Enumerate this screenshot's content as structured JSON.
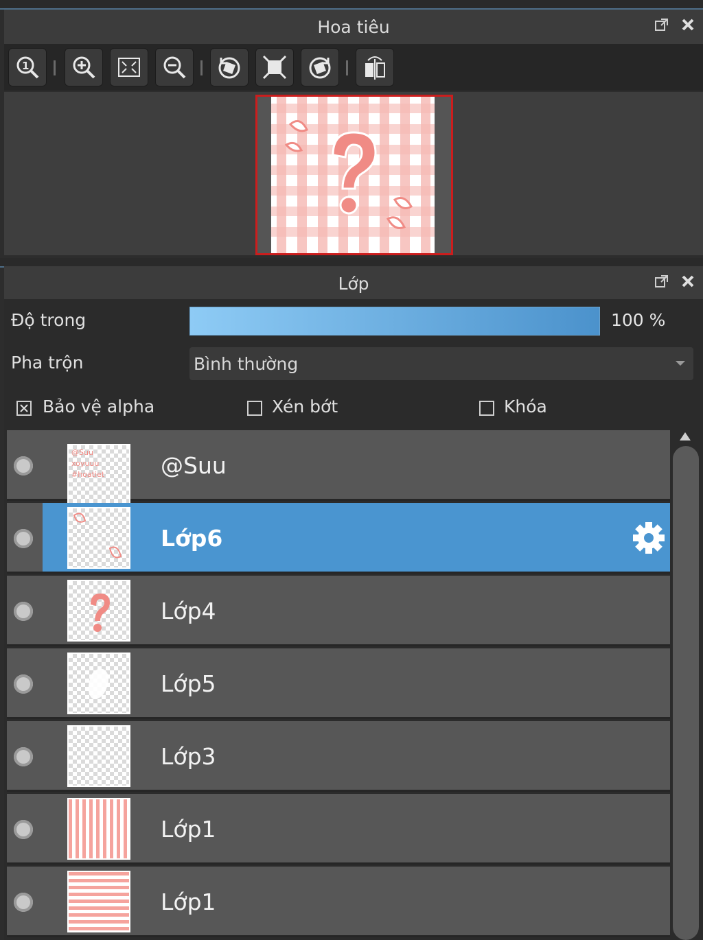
{
  "navigator": {
    "title": "Hoa tiêu",
    "toolbar": [
      {
        "icon": "zoom-actual-size-icon"
      },
      {
        "icon": "zoom-in-icon"
      },
      {
        "icon": "fit-to-window-icon"
      },
      {
        "icon": "zoom-out-icon"
      },
      {
        "icon": "rotate-left-icon"
      },
      {
        "icon": "reset-view-icon"
      },
      {
        "icon": "rotate-right-icon"
      },
      {
        "icon": "flip-horizontal-icon"
      }
    ]
  },
  "layers_panel": {
    "title": "Lớp",
    "opacity_label": "Độ trong",
    "opacity_value": "100 %",
    "opacity_fraction": 1.0,
    "blend_label": "Pha trộn",
    "blend_mode": "Bình thường",
    "checkboxes": {
      "protect_alpha": {
        "label": "Bảo vệ alpha",
        "checked": true
      },
      "clipping": {
        "label": "Xén bớt",
        "checked": false
      },
      "lock": {
        "label": "Khóa",
        "checked": false
      }
    },
    "layers": [
      {
        "name": "@Suu",
        "selected": false,
        "thumb": "text-pink"
      },
      {
        "name": "Lớp6",
        "selected": true,
        "thumb": "swirls"
      },
      {
        "name": "Lớp4",
        "selected": false,
        "thumb": "question-mark"
      },
      {
        "name": "Lớp5",
        "selected": false,
        "thumb": "white-shape"
      },
      {
        "name": "Lớp3",
        "selected": false,
        "thumb": "transparent"
      },
      {
        "name": "Lớp1",
        "selected": false,
        "thumb": "vertical-stripes"
      },
      {
        "name": "Lớp1",
        "selected": false,
        "thumb": "horizontal-stripes"
      }
    ]
  },
  "colors": {
    "selection": "#4a95d0",
    "thumbnail_border": "#cc1d1d",
    "accent_pink": "#f2938c"
  }
}
